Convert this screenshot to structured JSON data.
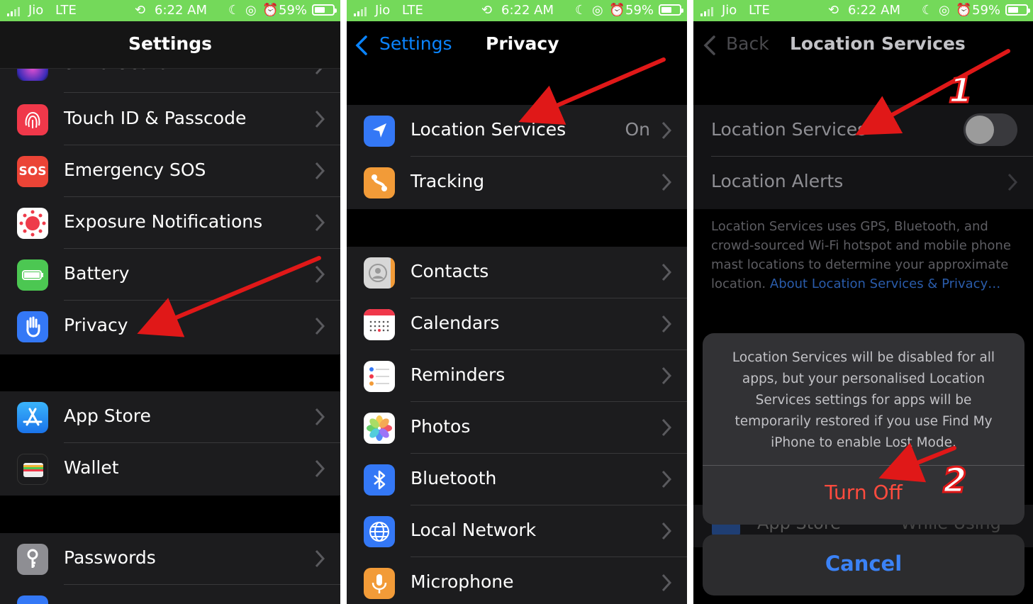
{
  "colors": {
    "status_bar": "#74d95a",
    "ios_blue": "#0a84ff",
    "arrow_red": "#e01818",
    "destructive": "#ff4b3e"
  },
  "status": {
    "carrier": "Jio",
    "network": "LTE",
    "time": "6:22 AM",
    "battery": "59%"
  },
  "panel1": {
    "title": "Settings",
    "partial_row": "Siri & Search",
    "rows": [
      {
        "label": "Touch ID & Passcode",
        "icon": "fingerprint-icon"
      },
      {
        "label": "Emergency SOS",
        "icon": "sos-icon",
        "icon_text": "SOS"
      },
      {
        "label": "Exposure Notifications",
        "icon": "exposure-icon"
      },
      {
        "label": "Battery",
        "icon": "battery-icon"
      },
      {
        "label": "Privacy",
        "icon": "hand-icon"
      },
      {
        "label": "App Store",
        "icon": "app-store-icon"
      },
      {
        "label": "Wallet",
        "icon": "wallet-icon"
      },
      {
        "label": "Passwords",
        "icon": "key-icon"
      }
    ]
  },
  "panel2": {
    "back": "Settings",
    "title": "Privacy",
    "rows": [
      {
        "label": "Location Services",
        "value": "On",
        "icon": "location-arrow-icon"
      },
      {
        "label": "Tracking",
        "icon": "tracking-icon"
      },
      {
        "label": "Contacts",
        "icon": "contacts-icon"
      },
      {
        "label": "Calendars",
        "icon": "calendar-icon"
      },
      {
        "label": "Reminders",
        "icon": "reminders-icon"
      },
      {
        "label": "Photos",
        "icon": "photos-icon"
      },
      {
        "label": "Bluetooth",
        "icon": "bluetooth-icon"
      },
      {
        "label": "Local Network",
        "icon": "globe-icon"
      },
      {
        "label": "Microphone",
        "icon": "microphone-icon"
      }
    ]
  },
  "panel3": {
    "back": "Back",
    "title": "Location Services",
    "toggle_label": "Location Services",
    "alerts_label": "Location Alerts",
    "description": "Location Services uses GPS, Bluetooth, and crowd-sourced Wi-Fi hotspot and mobile phone mast locations to determine your approximate location.",
    "link": "About Location Services & Privacy…",
    "dialog_message": "Location Services will be disabled for all apps, but your personalised Location Services settings for apps will be temporarily restored if you use Find My iPhone to enable Lost Mode.",
    "turn_off": "Turn Off",
    "cancel": "Cancel",
    "behind_app": "App Store",
    "behind_value": "While Using"
  },
  "annotations": {
    "step1": "1",
    "step2": "2"
  }
}
